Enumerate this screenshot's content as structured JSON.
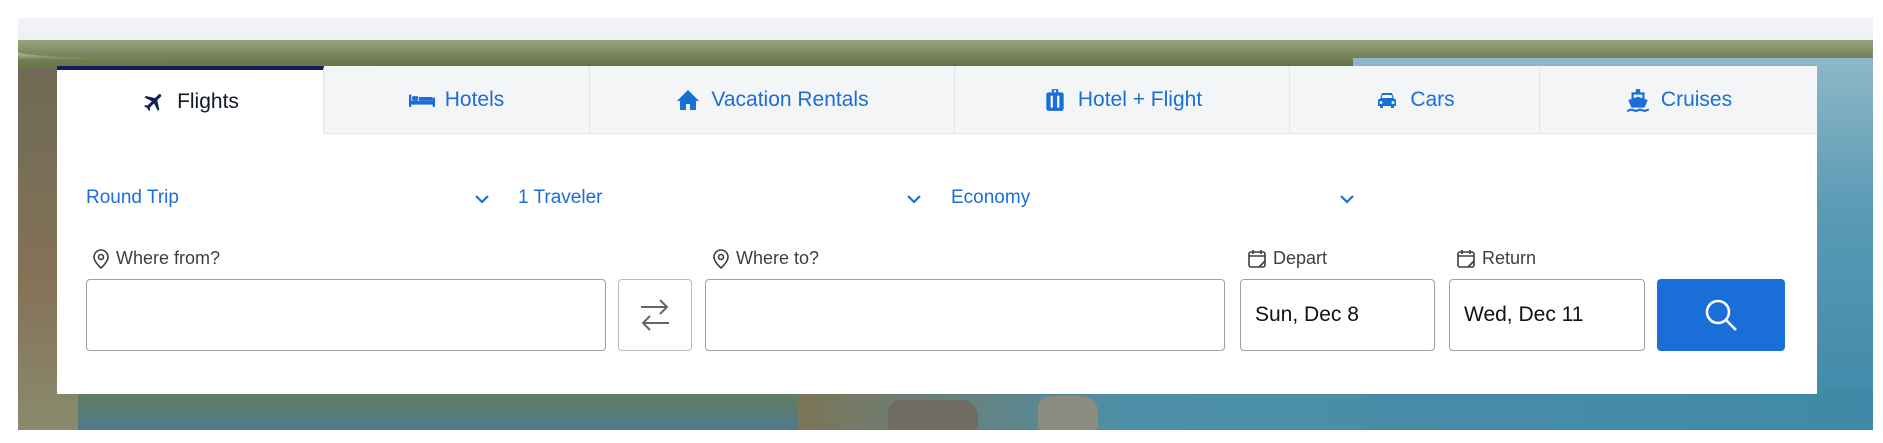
{
  "tabs": [
    {
      "label": "Flights",
      "icon": "airplane-icon",
      "active": true
    },
    {
      "label": "Hotels",
      "icon": "bed-icon",
      "active": false
    },
    {
      "label": "Vacation Rentals",
      "icon": "house-icon",
      "active": false
    },
    {
      "label": "Hotel + Flight",
      "icon": "luggage-icon",
      "active": false
    },
    {
      "label": "Cars",
      "icon": "car-icon",
      "active": false
    },
    {
      "label": "Cruises",
      "icon": "ship-icon",
      "active": false
    }
  ],
  "selectors": {
    "trip_type": "Round Trip",
    "travelers": "1 Traveler",
    "cabin": "Economy"
  },
  "fields": {
    "from_label": "Where from?",
    "from_value": "",
    "to_label": "Where to?",
    "to_value": "",
    "depart_label": "Depart",
    "depart_value": "Sun, Dec 8",
    "return_label": "Return",
    "return_value": "Wed, Dec 11"
  },
  "colors": {
    "accent": "#1a6ed8",
    "active_tab_bar": "#0e1f5b"
  }
}
